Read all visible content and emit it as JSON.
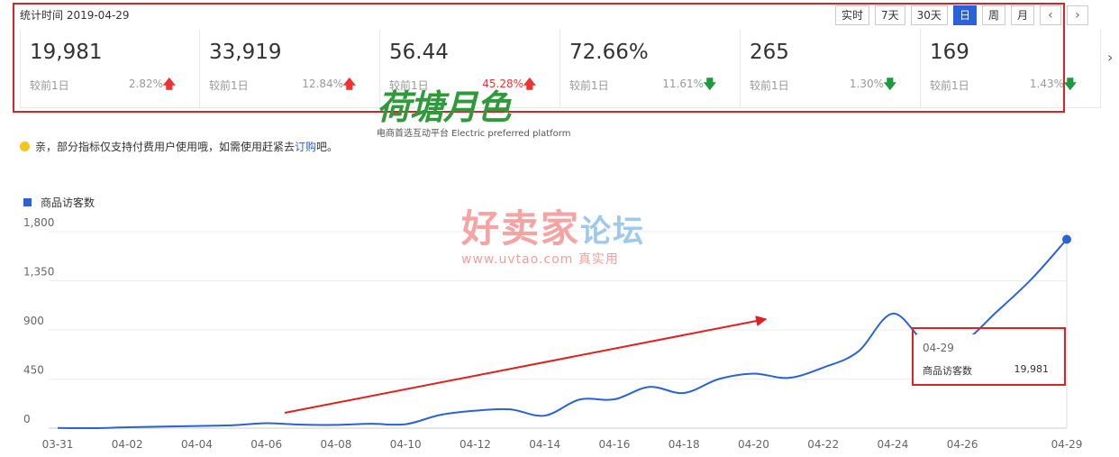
{
  "header": {
    "stat_date": "统计时间 2019-04-29"
  },
  "toolbar": {
    "buttons": [
      {
        "label": "实时",
        "active": false
      },
      {
        "label": "7天",
        "active": false
      },
      {
        "label": "30天",
        "active": false
      },
      {
        "label": "日",
        "active": true
      },
      {
        "label": "周",
        "active": false
      },
      {
        "label": "月",
        "active": false
      }
    ],
    "prev_icon": "‹",
    "next_icon": "›"
  },
  "cards": [
    {
      "value": "19,981",
      "compare": "较前1日",
      "pct": "2.82%",
      "trend": "up"
    },
    {
      "value": "33,919",
      "compare": "较前1日",
      "pct": "12.84%",
      "trend": "up"
    },
    {
      "value": "56.44",
      "compare": "较前1日",
      "pct": "45.28%",
      "trend": "up"
    },
    {
      "value": "72.66%",
      "compare": "较前1日",
      "pct": "11.61%",
      "trend": "down"
    },
    {
      "value": "265",
      "compare": "较前1日",
      "pct": "1.30%",
      "trend": "down"
    },
    {
      "value": "169",
      "compare": "较前1日",
      "pct": "1.43%",
      "trend": "down"
    }
  ],
  "notice": {
    "text": "亲，部分指标仅支持付费用户使用哦，如需使用赶紧去",
    "link": "订购",
    "suffix": "吧。"
  },
  "watermarks": {
    "brand1": "荷塘月色",
    "brand1_sub": "电商首选互动平台 Electric preferred platform",
    "brand2_main": "好卖家",
    "brand2_accent": "论坛",
    "brand2_sub": "www.uvtao.com 真实用"
  },
  "colors": {
    "accent": "#2962d9",
    "up": "#e33333",
    "down": "#1a9b3c",
    "highlight_box": "#d9232a"
  },
  "chart_data": {
    "type": "line",
    "series": [
      {
        "name": "商品访客数",
        "values": [
          2,
          0,
          8,
          14,
          20,
          26,
          45,
          32,
          30,
          40,
          36,
          122,
          160,
          172,
          115,
          262,
          264,
          378,
          322,
          450,
          500,
          460,
          555,
          700,
          1050,
          770,
          790,
          1070,
          1370,
          1730,
          1790
        ]
      }
    ],
    "x": [
      "03-31",
      "04-01",
      "04-02",
      "04-03",
      "04-04",
      "04-05",
      "04-06",
      "04-07",
      "04-08",
      "04-09",
      "04-10",
      "04-11",
      "04-12",
      "04-13",
      "04-14",
      "04-15",
      "04-16",
      "04-17",
      "04-18",
      "04-19",
      "04-20",
      "04-21",
      "04-22",
      "04-23",
      "04-24",
      "04-25",
      "04-26",
      "04-27",
      "04-28",
      "04-29"
    ],
    "x_tick_labels": [
      "03-31",
      "04-02",
      "04-04",
      "04-06",
      "04-08",
      "04-10",
      "04-12",
      "04-14",
      "04-16",
      "04-18",
      "04-20",
      "04-22",
      "04-24",
      "04-26",
      "04-29"
    ],
    "y_ticks": [
      "0",
      "450",
      "900",
      "1,350",
      "1,800"
    ],
    "ylim": [
      0,
      1800
    ],
    "legend": "top-left",
    "grid": true,
    "tooltip": {
      "date": "04-29",
      "name": "商品访客数",
      "value": "19,981"
    }
  }
}
